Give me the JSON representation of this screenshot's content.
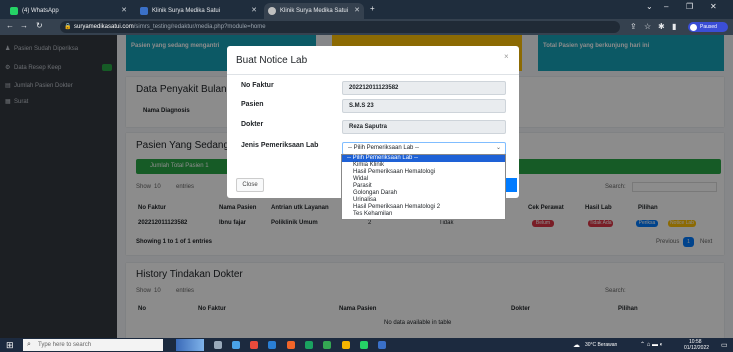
{
  "browser": {
    "tabs": [
      {
        "label": "(4) WhatsApp",
        "color": "#25d366"
      },
      {
        "label": "Klinik Surya Medika Satui",
        "color": "#3a70c8"
      },
      {
        "label": "Klinik Surya Medika Satui",
        "color": "#c0c0c0"
      }
    ],
    "new_tab": "+",
    "url_host": "suryamedikasatui.com",
    "url_path": "/simrs_testing/redaktur/media.php?module=home",
    "profile_label": "Paused"
  },
  "sidebar": {
    "items": [
      {
        "icon": "user-icon",
        "label": "Pasien Sudah Diperiksa"
      },
      {
        "icon": "gear-icon",
        "label": "Data Resep Keep"
      },
      {
        "icon": "list-icon",
        "label": "Jumlah Pasien Dokter"
      },
      {
        "icon": "document-icon",
        "label": "Surat"
      }
    ]
  },
  "info_boxes": [
    {
      "label": "Pasien yang sedang mengantri",
      "color": "#17a2b8"
    },
    {
      "label": "",
      "color": "#ffc107"
    },
    {
      "label": "Total Pasien yang berkunjung hari ini",
      "color": "#17a2b8"
    }
  ],
  "main": {
    "card1_title": "Data Penyakit Bulan Ini",
    "card1_col": "Nama Diagnosis",
    "card2_title": "Pasien Yang Sedang Menunggu",
    "total_label": "Jumlah Total Pasien 1",
    "show_label": "Show",
    "entries_label": "entries",
    "show_value": "10",
    "search_label": "Search:",
    "columns": [
      "No Faktur",
      "Nama Pasien",
      "Antrian utk Layanan",
      "",
      "",
      "Cek Perawat",
      "Hasil Lab",
      "Pilihan"
    ],
    "row": [
      "202212011123582",
      "Ibnu fajar",
      "Poliklinik Umum",
      "2",
      "Tidak"
    ],
    "status_cek": "Belum",
    "status_lab": "Tidak Ada",
    "btn_periksa": "Periksa",
    "btn_notice": "Notice Lab",
    "showing": "Showing 1 to 1 of 1 entries",
    "previous": "Previous",
    "page": "1",
    "next": "Next",
    "card3_title": "History Tindakan Dokter",
    "card3_columns": [
      "No",
      "No Faktur",
      "Nama Pasien",
      "Dokter",
      "Pilihan"
    ],
    "no_data": "No data available in table"
  },
  "modal": {
    "title": "Buat Notice Lab",
    "close_x": "×",
    "fields": [
      {
        "label": "No Faktur",
        "value": "202212011123582"
      },
      {
        "label": "Pasien",
        "value": "S.M.S 23"
      },
      {
        "label": "Dokter",
        "value": "Reza Saputra"
      }
    ],
    "select_label": "Jenis Pemeriksaan Lab",
    "select_value": "-- Pilih Pemeriksaan Lab --",
    "close_button": "Close",
    "options": [
      "-- Pilih Pemeriksaan Lab --",
      "Kimia Klinik",
      "Hasil Pemeriksaan Hematologi",
      "Widal",
      "Parasit",
      "Golongan Darah",
      "Urinalisa",
      "Hasil Pemeriksaan Hematologi 2",
      "Tes Kehamilan"
    ]
  },
  "taskbar": {
    "search_placeholder": "Type here to search",
    "weather": "30°C Berawan",
    "time": "10:58",
    "date": "01/12/2022"
  }
}
